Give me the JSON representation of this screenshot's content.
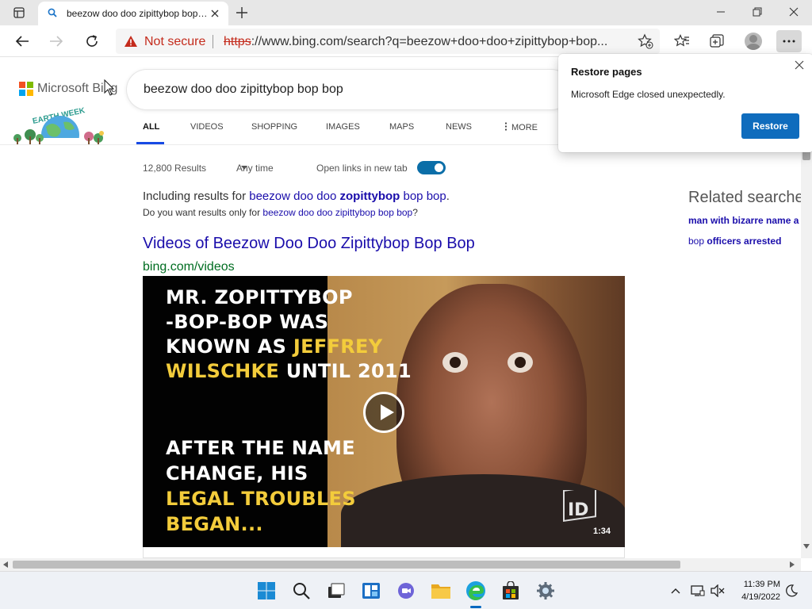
{
  "browser": {
    "tab": {
      "title": "beezow doo doo zipittybop bop bop"
    },
    "address": {
      "security_label": "Not secure",
      "url_scheme": "https",
      "url_rest": "://www.bing.com/search?q=beezow+doo+doo+zipittybop+bop..."
    }
  },
  "bing": {
    "logo_text": "Microsoft Bing",
    "logo_colors": [
      "#f25022",
      "#7fba00",
      "#00a4ef",
      "#ffb900"
    ],
    "doodle_text": "EARTH WEEK",
    "query": "beezow doo doo zipittybop bop bop",
    "scopes": [
      "ALL",
      "VIDEOS",
      "SHOPPING",
      "IMAGES",
      "MAPS",
      "NEWS",
      "MORE"
    ],
    "filters": {
      "results_count": "12,800 Results",
      "time_filter": "Any time",
      "new_tab_label": "Open links in new tab"
    },
    "spelling": {
      "including_prefix": "Including results for ",
      "including_part1": "beezow doo doo ",
      "including_bold": "zopittybop",
      "including_part2": " bop bop",
      "including_suffix": ".",
      "alt_prefix": "Do you want results only for ",
      "alt_link": "beezow doo doo zipittybop bop bop",
      "alt_suffix": "?"
    },
    "result": {
      "title": "Videos of Beezow Doo Doo Zipittybop Bop Bop",
      "url": "bing.com/videos"
    },
    "video": {
      "lines": [
        {
          "white1": "MR. ZOPITTYBOP",
          "yellow": "",
          "white2": ""
        },
        {
          "white1": "-BOP-BOP WAS",
          "yellow": "",
          "white2": ""
        },
        {
          "white1": "KNOWN AS ",
          "yellow": "JEFFREY",
          "white2": ""
        },
        {
          "white1": "",
          "yellow": "WILSCHKE",
          "white2": " UNTIL 2011"
        },
        {
          "white1": "AFTER THE NAME",
          "yellow": "",
          "white2": ""
        },
        {
          "white1": "CHANGE, HIS",
          "yellow": "",
          "white2": ""
        },
        {
          "white1": "",
          "yellow": "LEGAL TROUBLES",
          "white2": ""
        },
        {
          "white1": "",
          "yellow": "BEGAN...",
          "white2": ""
        }
      ],
      "duration": "1:34",
      "logo_text": "ID"
    },
    "related": {
      "title": "Related searches",
      "link1": "man with bizarre name a",
      "link2_plain": "bop ",
      "link2_bold": "officers arrested"
    }
  },
  "restore_popup": {
    "title": "Restore pages",
    "message": "Microsoft Edge closed unexpectedly.",
    "button": "Restore"
  },
  "taskbar": {
    "time": "11:39 PM",
    "date": "4/19/2022"
  }
}
